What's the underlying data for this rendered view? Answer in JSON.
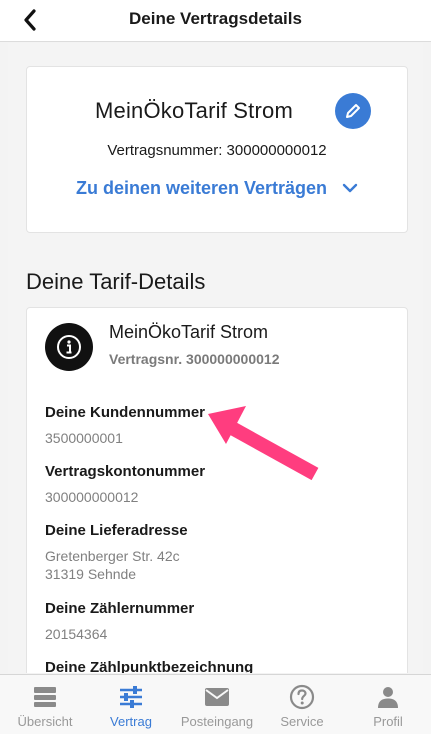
{
  "header": {
    "title": "Deine Vertragsdetails"
  },
  "contract_card": {
    "tariff_name": "MeinÖkoTarif Strom",
    "contract_number": "Vertragsnummer: 300000000012",
    "more_contracts_link": "Zu deinen weiteren Verträgen"
  },
  "tariff_details": {
    "section_title": "Deine Tarif-Details",
    "tariff_name": "MeinÖkoTarif Strom",
    "contract_number": "Vertragsnr. 300000000012",
    "fields": [
      {
        "label": "Deine Kundennummer",
        "value": "3500000001"
      },
      {
        "label": "Vertragskontonummer",
        "value": "300000000012"
      },
      {
        "label": "Deine Lieferadresse",
        "value": "Gretenberger Str. 42c",
        "value2": "31319 Sehnde"
      },
      {
        "label": "Deine Zählernummer",
        "value": "20154364"
      },
      {
        "label": "Deine Zählpunktbezeichnung"
      }
    ]
  },
  "tabbar": {
    "tabs": [
      {
        "label": "Übersicht",
        "icon": "overview-icon",
        "active": false
      },
      {
        "label": "Vertrag",
        "icon": "sliders-icon",
        "active": true
      },
      {
        "label": "Posteingang",
        "icon": "mail-icon",
        "active": false
      },
      {
        "label": "Service",
        "icon": "help-icon",
        "active": false
      },
      {
        "label": "Profil",
        "icon": "profile-icon",
        "active": false
      }
    ]
  },
  "colors": {
    "accent": "#3a7bd5",
    "arrow": "#ff3d7f",
    "inactive": "#999999"
  }
}
